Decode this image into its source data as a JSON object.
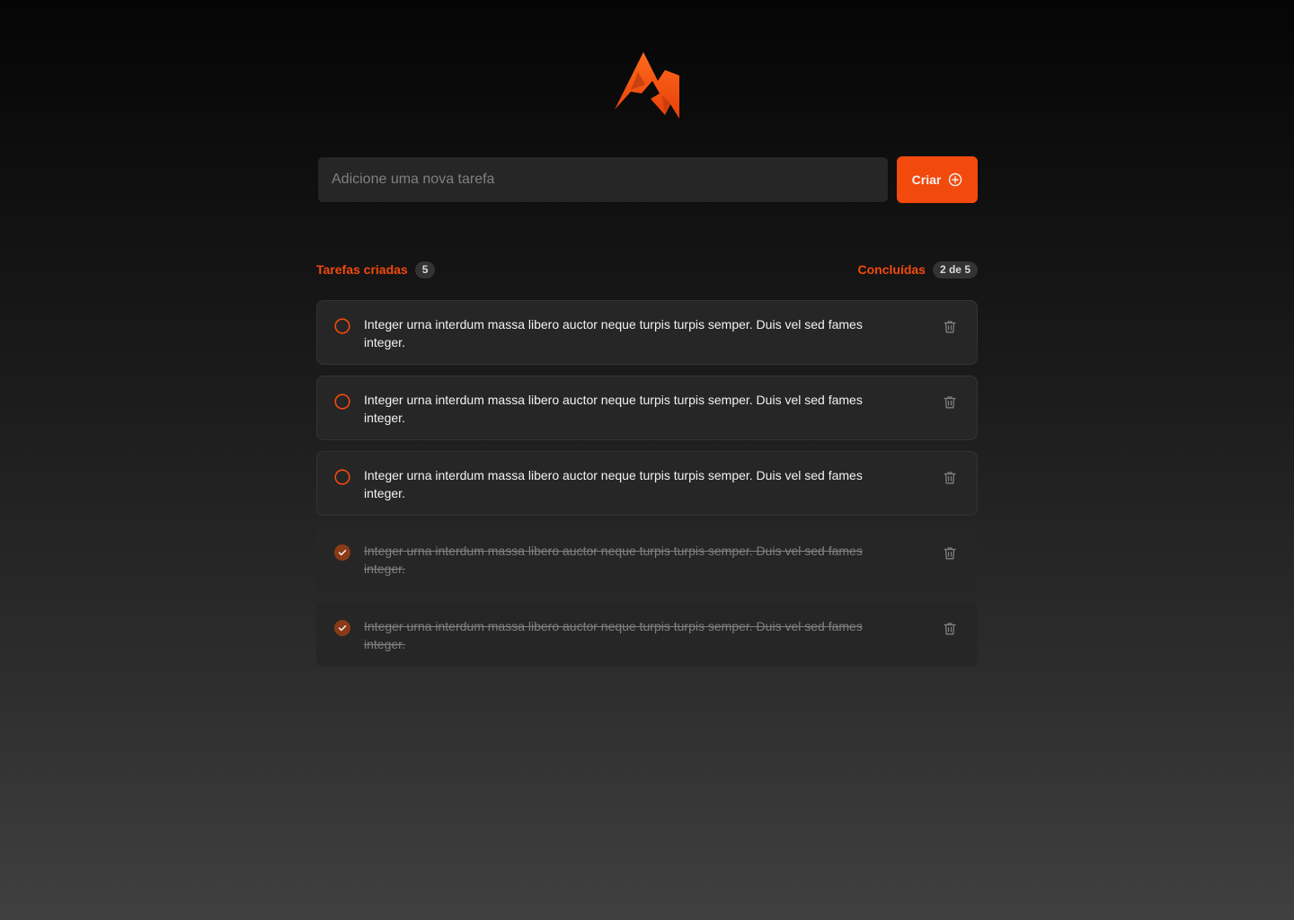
{
  "app": {
    "logo_icon": "lightning-m-logo-icon"
  },
  "new_task": {
    "placeholder": "Adicione uma nova tarefa",
    "value": "",
    "create_label": "Criar",
    "create_icon": "plus-circle-icon"
  },
  "counters": {
    "created_label": "Tarefas criadas",
    "created_count": "5",
    "done_label": "Concluídas",
    "done_count": "2 de 5"
  },
  "tasks": [
    {
      "text": "Integer urna interdum massa libero auctor neque turpis turpis semper. Duis vel sed fames integer.",
      "done": false
    },
    {
      "text": "Integer urna interdum massa libero auctor neque turpis turpis semper. Duis vel sed fames integer.",
      "done": false
    },
    {
      "text": "Integer urna interdum massa libero auctor neque turpis turpis semper. Duis vel sed fames integer.",
      "done": false
    },
    {
      "text": "Integer urna interdum massa libero auctor neque turpis turpis semper. Duis vel sed fames integer.",
      "done": true
    },
    {
      "text": "Integer urna interdum massa libero auctor neque turpis turpis semper. Duis vel sed fames integer.",
      "done": true
    }
  ],
  "colors": {
    "accent": "#f24a0c",
    "done_check": "#8a3a17",
    "surface": "#262626",
    "muted_text": "#808080"
  }
}
